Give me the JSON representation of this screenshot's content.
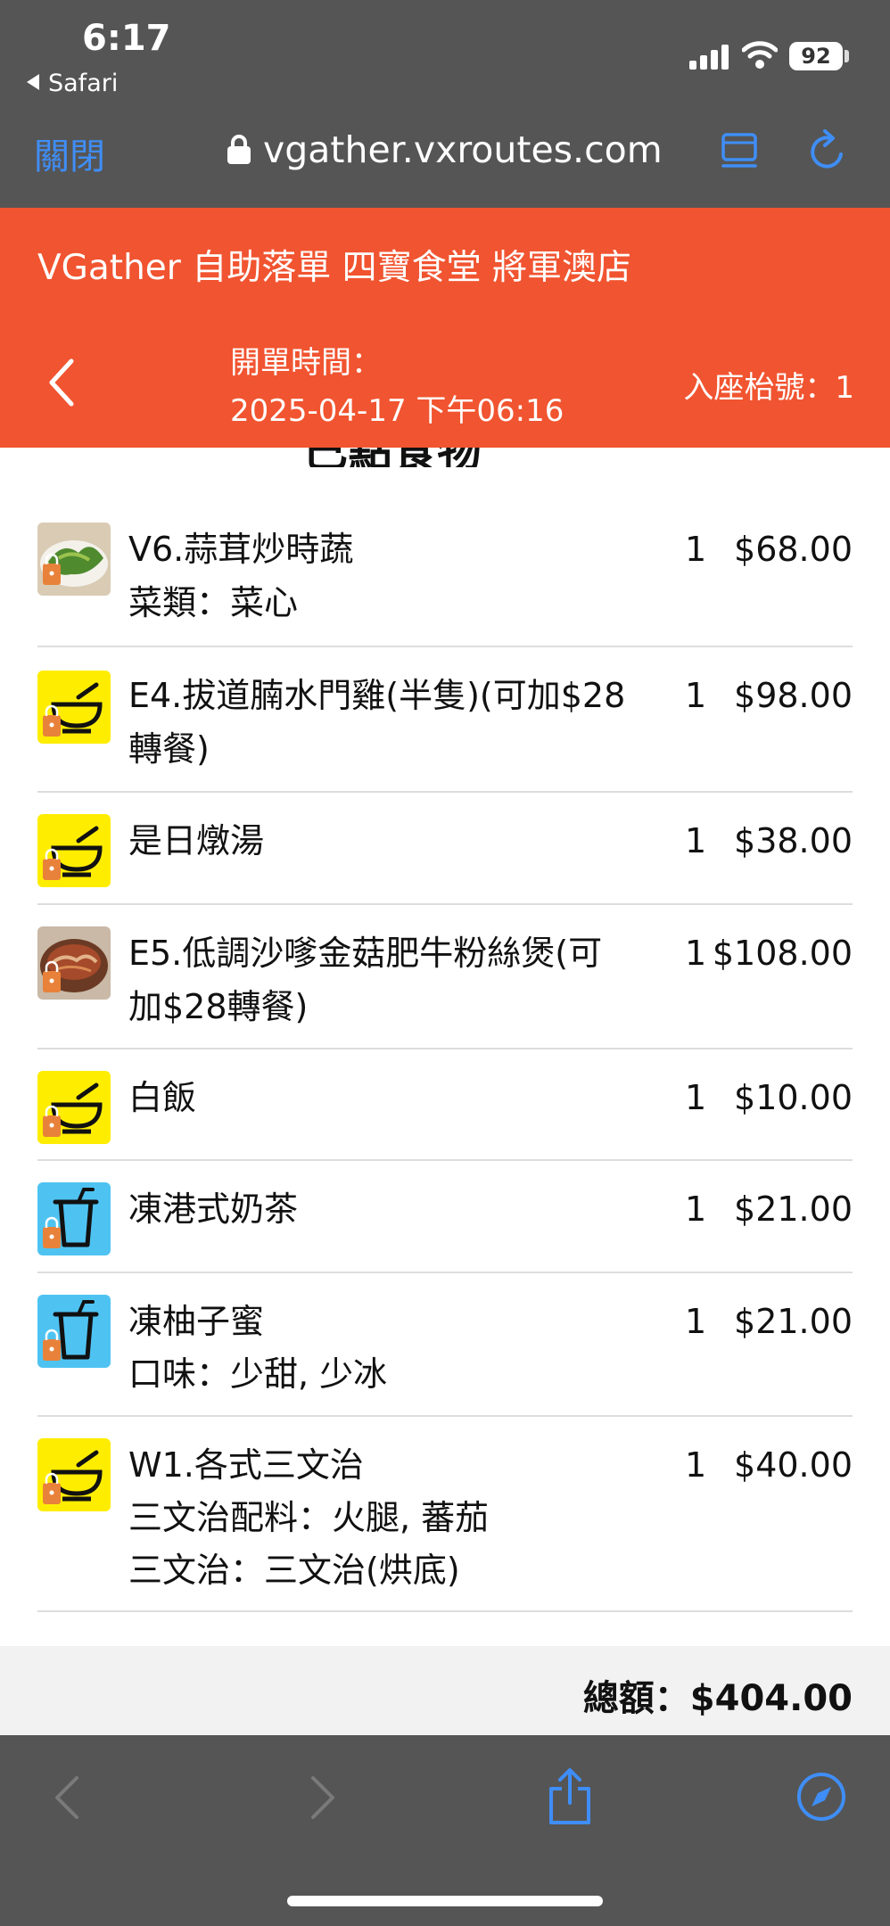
{
  "status_bar": {
    "time": "6:17",
    "back_app": "Safari",
    "battery": "92"
  },
  "browser": {
    "close_label": "關閉",
    "url": "vgather.vxroutes.com"
  },
  "header": {
    "store_title": "VGather 自助落單 四寶食堂 將軍澳店",
    "open_time_label": "開單時間：",
    "open_time_value": "2025-04-17 下午06:16",
    "seat_label": "入座枱號：1"
  },
  "section_heading": "已點食物",
  "items": [
    {
      "name": "V6.蒜茸炒時蔬",
      "options": [
        "菜類：菜心"
      ],
      "qty": "1",
      "price": "$68.00",
      "icon": "veg-photo"
    },
    {
      "name": "E4.拔道腩水門雞(半隻)(可加$28轉餐)",
      "options": [],
      "qty": "1",
      "price": "$98.00",
      "icon": "bowl-icon"
    },
    {
      "name": "是日燉湯",
      "options": [],
      "qty": "1",
      "price": "$38.00",
      "icon": "bowl-icon"
    },
    {
      "name": "E5.低調沙嗲金菇肥牛粉絲煲(可加$28轉餐)",
      "options": [],
      "qty": "1",
      "price": "$108.00",
      "icon": "beef-photo"
    },
    {
      "name": "白飯",
      "options": [],
      "qty": "1",
      "price": "$10.00",
      "icon": "bowl-icon"
    },
    {
      "name": "凍港式奶茶",
      "options": [],
      "qty": "1",
      "price": "$21.00",
      "icon": "cup-icon"
    },
    {
      "name": "凍柚子蜜",
      "options": [
        "口味：少甜, 少冰"
      ],
      "qty": "1",
      "price": "$21.00",
      "icon": "cup-icon"
    },
    {
      "name": "W1.各式三文治",
      "options": [
        "三文治配料：火腿, 蕃茄",
        "三文治：三文治(烘底)"
      ],
      "qty": "1",
      "price": "$40.00",
      "icon": "bowl-icon"
    }
  ],
  "total_label": "總額：$404.00",
  "colors": {
    "brand": "#f15430",
    "link": "#3f8ef7",
    "chrome": "#555555",
    "bowl_bg": "#ffed00",
    "cup_bg": "#4ec3f2",
    "lock_badge": "#e8823a"
  }
}
